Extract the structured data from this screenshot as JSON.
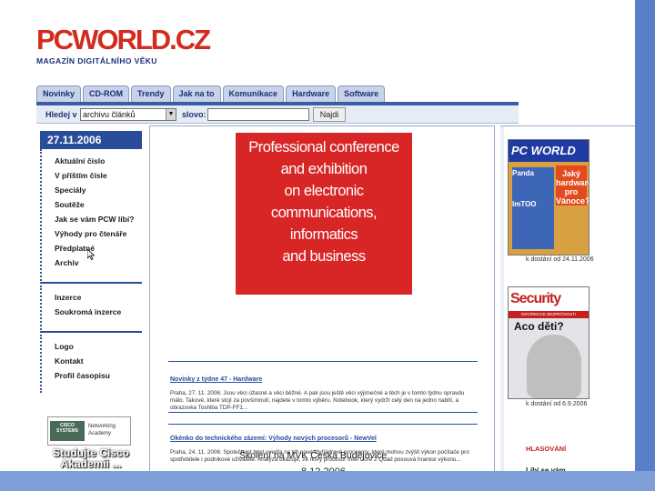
{
  "logo": {
    "pc": "PC",
    "world": "WORLD",
    "cz": ".CZ",
    "tagline": "MAGAZÍN DIGITÁLNÍHO VĚKU"
  },
  "tabs": [
    "Novinky",
    "CD-ROM",
    "Trendy",
    "Jak na to",
    "Komunikace",
    "Hardware",
    "Software"
  ],
  "search": {
    "label1": "Hledej v",
    "select_value": "archivu článků",
    "label2": "slovo:",
    "input_value": "",
    "button_label": "Najdi"
  },
  "sidebar": {
    "date": "27.11.2006",
    "group1": [
      "Aktuální číslo",
      "V příštím čísle",
      "Speciály",
      "Soutěže",
      "Jak se vám PCW líbí?",
      "Výhody pro čtenáře",
      "Předplatné",
      "Archiv"
    ],
    "group2": [
      "Inzerce",
      "Soukromá inzerce"
    ],
    "group3": [
      "Logo",
      "Kontakt",
      "Profil časopisu"
    ],
    "cisco_logo_left": "CISCO SYSTEMS",
    "cisco_logo_right": "Networking Academy",
    "cisco_promo": "Studujte Cisco Akademii ..."
  },
  "banner": {
    "lines": [
      "Professional conference",
      "and exhibition",
      "on electronic",
      "communications,",
      "informatics",
      "and business"
    ]
  },
  "news": [
    {
      "title": "Novinky z týdne 47 - Hardware",
      "body": "Praha, 27. 11. 2006: Jsou věci úžasné a věci běžné. A pak jsou ještě věci výjimečné a těch je v tomto týdnu opravdu málo. Takové, které stojí za povšimnutí, najdete v tomto výběru. Notebook, který vydrží celý den na jedno nabití, a obrazovka Toshiba TDP-FF1..."
    },
    {
      "title": "Okénko do technického zázemí: Výhody nových procesorů - NewVel",
      "body": "Praha, 24. 11. 2006: Společnost Intel uvedla na trh nové čtyřjádrové procesory, které mohou zvýšit výkon počítače pro spotřebitele i podnikové uživatele. Analýza ukazuje, že nový procesor Intel Core 2 Quad posouvá hranice výkonu..."
    }
  ],
  "overlay": {
    "text": "Školení na MVK Česká Budějovice",
    "date": "8.12.2006"
  },
  "right": {
    "cover1_head": "PC WORLD",
    "cover1_red": "Jaký hardware pro Vánoce?",
    "cover1_label1": "Panda",
    "cover1_label2": "ImTOO",
    "cover1_caption": "k dostání od 24.11.2006",
    "cover2_head": "Security",
    "cover2_sub": "INFORMACE BEZPEČNOSTI",
    "cover2_title": "Aco děti?",
    "cover2_caption": "k dostání od 6.9.2006",
    "poll_title": "HLASOVÁNÍ",
    "poll_question": "Líbí se vám"
  },
  "colors": {
    "brand_red": "#d22b1f",
    "nav_blue": "#2a4d9b",
    "slide_frame": "#5a7fc8"
  }
}
